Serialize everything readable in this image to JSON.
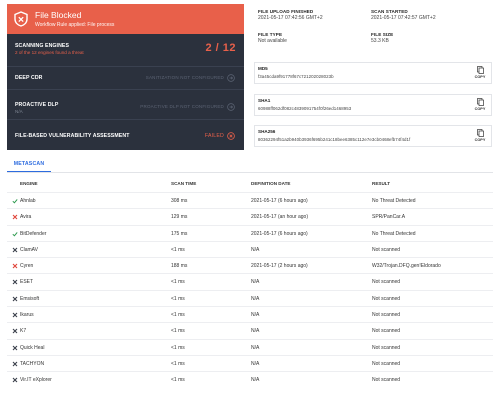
{
  "verdict": {
    "title": "File Blocked",
    "subtitle": "Workflow Rule applied: File process",
    "color": "#e8604a"
  },
  "panel": {
    "scan": {
      "label": "SCANNING ENGINES",
      "sub": "2 of the 12 engines found a threat",
      "count": "2 / 12"
    },
    "cdr": {
      "label": "DEEP CDR",
      "status": "SANITIZATION NOT CONFIGURED"
    },
    "dlp": {
      "label": "PROACTIVE DLP",
      "sub": "N/A",
      "status": "PROACTIVE DLP NOT CONFIGURED"
    },
    "vuln": {
      "label": "FILE-BASED VULNERABILITY ASSESSMENT",
      "status": "FAILED"
    }
  },
  "file_info": {
    "upload_finished": {
      "label": "FILE UPLOAD FINISHED",
      "value": "2021-05-17 07:42:56 GMT+2"
    },
    "scan_started": {
      "label": "SCAN STARTED",
      "value": "2021-05-17 07:42:57 GMT+2"
    },
    "file_type": {
      "label": "FILE TYPE",
      "value": "Not available"
    },
    "file_size": {
      "label": "FILE SIZE",
      "value": "53.3 KB"
    }
  },
  "hashes": [
    {
      "label": "MD5",
      "value": "f3a45cda9f91778f67c721202028023b",
      "copy": "COPY"
    },
    {
      "label": "SHA1",
      "value": "60988ff062df082c4839091754f0f26ed1468953",
      "copy": "COPY"
    },
    {
      "label": "SHA256",
      "value": "80362294f51a2b940b3936f695b241c18bee6385c112e7e3cb0468efb74f4d1f",
      "copy": "COPY"
    }
  ],
  "tabs": [
    "METASCAN"
  ],
  "table": {
    "headers": [
      "ENGINE",
      "SCAN TIME",
      "DEFINITION DATE",
      "RESULT"
    ],
    "rows": [
      {
        "icon": "check",
        "engine": "Ahnlab",
        "time": "308 ms",
        "date": "2021-05-17 (6 hours ago)",
        "result": "No Threat Detected"
      },
      {
        "icon": "cross-red",
        "engine": "Avira",
        "time": "129 ms",
        "date": "2021-05-17 (an hour ago)",
        "result": "SPR/PanCar.A"
      },
      {
        "icon": "check",
        "engine": "BitDefender",
        "time": "175 ms",
        "date": "2021-05-17 (6 hours ago)",
        "result": "No Threat Detected"
      },
      {
        "icon": "cross-dark",
        "engine": "ClamAV",
        "time": "<1 ms",
        "date": "N/A",
        "result": "Not scanned"
      },
      {
        "icon": "cross-red",
        "engine": "Cyren",
        "time": "188 ms",
        "date": "2021-05-17 (2 hours ago)",
        "result": "W32/Trojan.DFQ.gen!Eldorado"
      },
      {
        "icon": "cross-dark",
        "engine": "ESET",
        "time": "<1 ms",
        "date": "N/A",
        "result": "Not scanned"
      },
      {
        "icon": "cross-dark",
        "engine": "Emsisoft",
        "time": "<1 ms",
        "date": "N/A",
        "result": "Not scanned"
      },
      {
        "icon": "cross-dark",
        "engine": "Ikarus",
        "time": "<1 ms",
        "date": "N/A",
        "result": "Not scanned"
      },
      {
        "icon": "cross-dark",
        "engine": "K7",
        "time": "<1 ms",
        "date": "N/A",
        "result": "Not scanned"
      },
      {
        "icon": "cross-dark",
        "engine": "Quick Heal",
        "time": "<1 ms",
        "date": "N/A",
        "result": "Not scanned"
      },
      {
        "icon": "cross-dark",
        "engine": "TACHYON",
        "time": "<1 ms",
        "date": "N/A",
        "result": "Not scanned"
      },
      {
        "icon": "cross-dark",
        "engine": "Vir.IT eXplorer",
        "time": "<1 ms",
        "date": "N/A",
        "result": "Not scanned"
      }
    ]
  }
}
